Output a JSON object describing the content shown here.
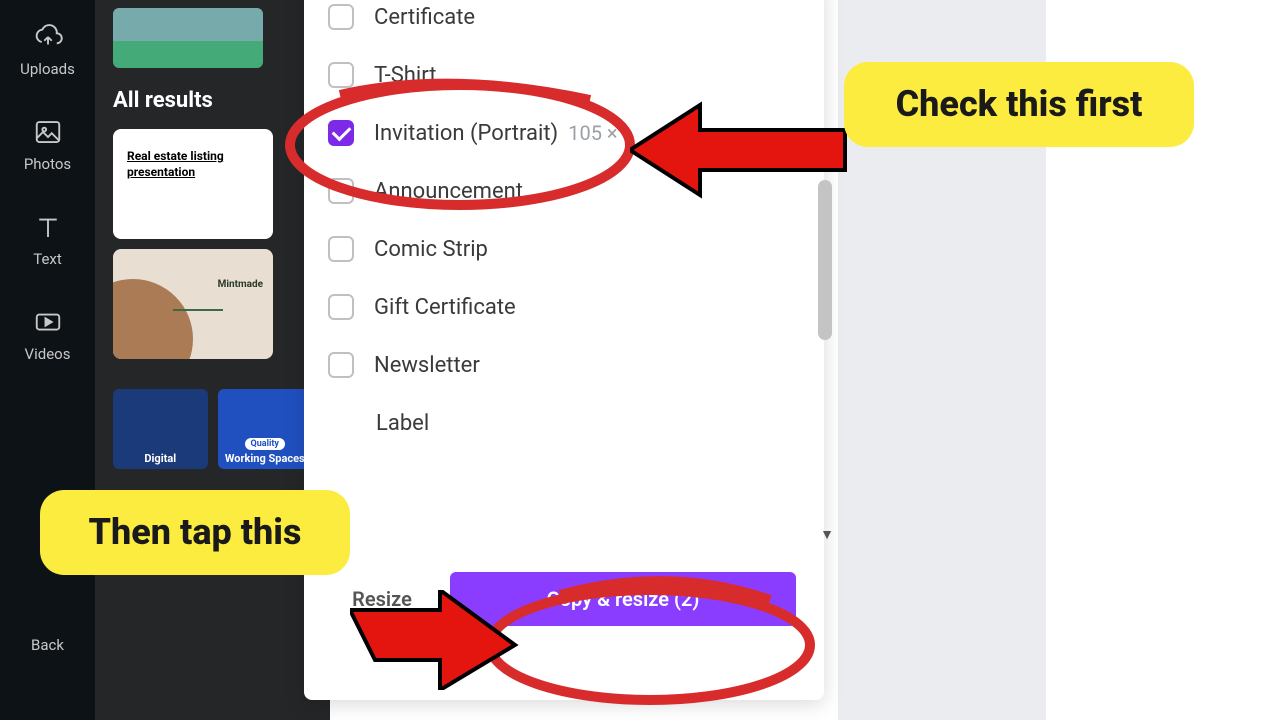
{
  "sidebar": {
    "items": [
      {
        "label": "Uploads",
        "icon": "upload"
      },
      {
        "label": "Photos",
        "icon": "image"
      },
      {
        "label": "Text",
        "icon": "text"
      },
      {
        "label": "Videos",
        "icon": "video"
      },
      {
        "label": "Back",
        "icon": "back"
      }
    ]
  },
  "panel": {
    "heading": "All results",
    "card1_line1": "Real estate listing",
    "card1_line2": "presentation",
    "card2_title": "Mintmade",
    "bc1": "Digital",
    "bc2_pill": "Quality",
    "bc2": "Working Spaces"
  },
  "dropdown": {
    "options": [
      {
        "label": "Certificate",
        "checked": false
      },
      {
        "label": "T-Shirt",
        "checked": false
      },
      {
        "label": "Invitation (Portrait)",
        "checked": true,
        "dims": "105 ×"
      },
      {
        "label": "Announcement",
        "checked": false
      },
      {
        "label": "Comic Strip",
        "checked": false
      },
      {
        "label": "Gift Certificate",
        "checked": false
      },
      {
        "label": "Newsletter",
        "checked": false
      },
      {
        "label": "Label",
        "checked": false
      }
    ],
    "resize_label": "Resize",
    "copy_label": "Copy & resize (2)"
  },
  "annotations": {
    "a1": "Check this first",
    "a2": "Then tap this"
  }
}
